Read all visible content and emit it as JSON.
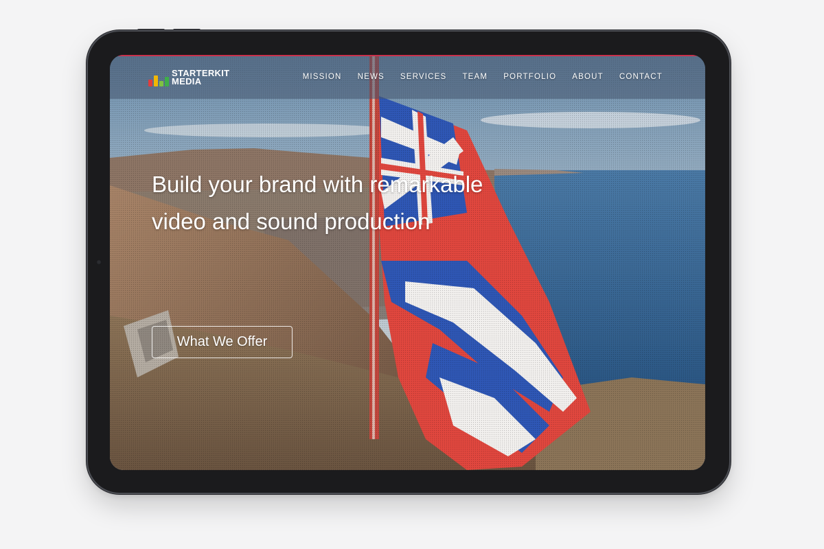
{
  "brand": {
    "logo_line1": "STARTERKIT",
    "logo_line2": "MEDIA",
    "logo_bar_colors": [
      "#e23d3d",
      "#f2b705",
      "#7fc242",
      "#3fae49"
    ]
  },
  "nav": {
    "items": [
      {
        "label": "MISSION"
      },
      {
        "label": "NEWS"
      },
      {
        "label": "SERVICES"
      },
      {
        "label": "TEAM"
      },
      {
        "label": "PORTFOLIO"
      },
      {
        "label": "ABOUT"
      },
      {
        "label": "CONTACT"
      }
    ]
  },
  "hero": {
    "title_line1": "Build your brand with remarkable",
    "title_line2": "video and sound production",
    "cta_label": "What We Offer"
  },
  "colors": {
    "accent_line": "#c9304a",
    "flag_red": "#e0473e",
    "flag_blue": "#2f57b5",
    "ocean": "#2c5a86"
  }
}
